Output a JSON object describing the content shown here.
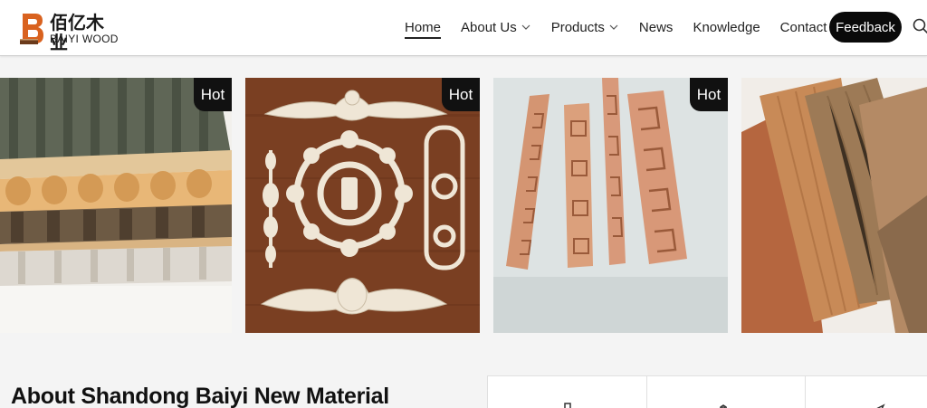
{
  "brand": {
    "name_cn": "佰亿木业",
    "name_en": "BAIYI WOOD",
    "accent_color": "#d9621f"
  },
  "nav": {
    "items": [
      {
        "label": "Home",
        "active": true,
        "has_dropdown": false
      },
      {
        "label": "About Us",
        "active": false,
        "has_dropdown": true
      },
      {
        "label": "Products",
        "active": false,
        "has_dropdown": true
      },
      {
        "label": "News",
        "active": false,
        "has_dropdown": false
      },
      {
        "label": "Knowledge",
        "active": false,
        "has_dropdown": false
      },
      {
        "label": "Contact Us",
        "active": false,
        "has_dropdown": false
      }
    ],
    "feedback_label": "Feedback",
    "search_icon": "search-icon"
  },
  "products": [
    {
      "badge": "Hot",
      "image": "fluted-wall-panels"
    },
    {
      "badge": "Hot",
      "image": "carved-wood-appliques"
    },
    {
      "badge": "Hot",
      "image": "carved-wood-trim-strips"
    },
    {
      "badge": "",
      "image": "wood-veneer-sheets"
    }
  ],
  "about": {
    "title": "About Shandong Baiyi New Material"
  }
}
